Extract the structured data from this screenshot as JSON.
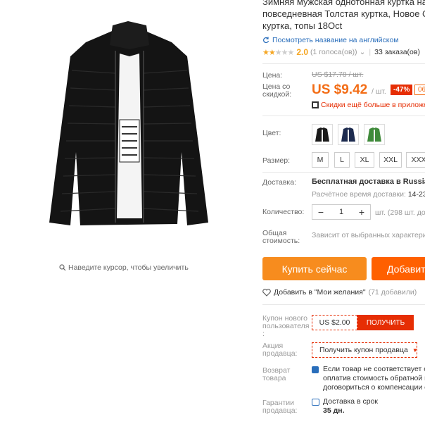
{
  "product": {
    "title_line1": "Зимняя мужская однотонная куртка на",
    "title_line2": "повседневная Толстая куртка, Новое Ст",
    "title_line3": "куртка, топы 18Oct",
    "translate_link": "Посмотреть название на английском",
    "rating": "2.0",
    "votes": "(1 голоса(ов))",
    "orders": "33 заказа(ов)",
    "zoom_hint": "Наведите курсор, чтобы увеличить"
  },
  "price": {
    "label_price": "Цена:",
    "old_price": "US $17.78 / шт.",
    "label_discount_price_1": "Цена со",
    "label_discount_price_2": "скидкой:",
    "price": "US $9.42",
    "per_unit": "/ шт.",
    "discount": "-47%",
    "badge2": "06",
    "app_discount": "Скидки ещё больше в приложе"
  },
  "options": {
    "color_label": "Цвет:",
    "colors": [
      "#1a1a1a",
      "#1d2b4f",
      "#3f8a3a"
    ],
    "size_label": "Размер:",
    "sizes": [
      "M",
      "L",
      "XL",
      "XXL",
      "XXX"
    ]
  },
  "shipping": {
    "label": "Доставка:",
    "main": "Бесплатная доставка в Russian F",
    "est_label": "Расчётное время доставки:",
    "est_value": "14-23"
  },
  "quantity": {
    "label": "Количество:",
    "minus": "−",
    "value": "1",
    "plus": "+",
    "stock": "шт. (298 шт. дос"
  },
  "total": {
    "label_1": "Общая",
    "label_2": "стоимость:",
    "value": "Зависит от выбранных характери"
  },
  "actions": {
    "buy_now": "Купить сейчас",
    "add_to_cart": "Добавит",
    "wishlist": "Добавить в \"Мои желания\"",
    "wishlist_count": "(71 добавили)"
  },
  "coupons": {
    "new_user_label_1": "Купон нового",
    "new_user_label_2": "пользователя",
    "new_user_label_3": ":",
    "new_user_value": "US $2.00",
    "new_user_get": "ПОЛУЧИТЬ",
    "seller_label_1": "Акция",
    "seller_label_2": "продавца:",
    "seller_coupon": "Получить купон продавца"
  },
  "returns": {
    "label_1": "Возврат",
    "label_2": "товара",
    "line1": "Если товар не соответствует оп",
    "line2": "оплатив стоимость обратной п",
    "line3": "договориться о компенсации с"
  },
  "guarantee": {
    "label_1": "Гарантии",
    "label_2": "продавца:",
    "line1": "Доставка в срок",
    "line2": "35 дн."
  }
}
